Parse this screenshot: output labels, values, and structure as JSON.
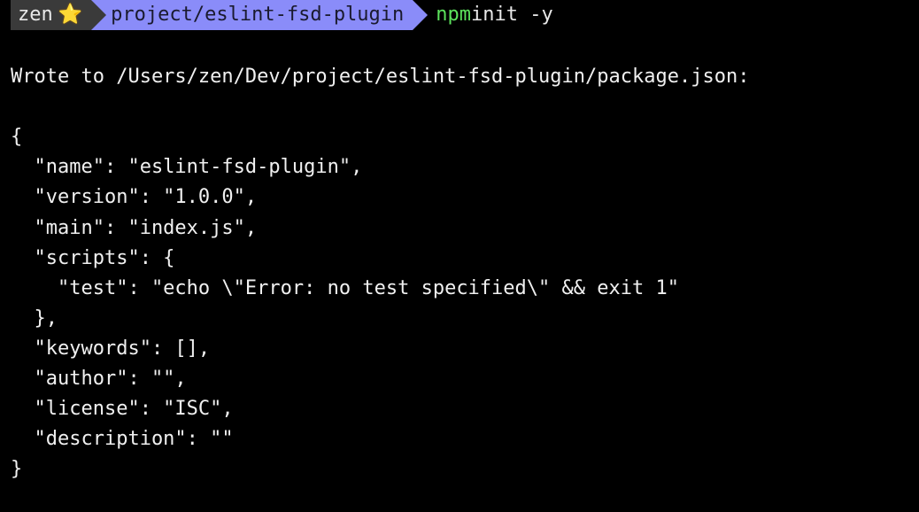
{
  "prompt": {
    "user": "zen",
    "star": "⭐",
    "path": "project/eslint-fsd-plugin",
    "cmd_bin": "npm",
    "cmd_args": " init -y"
  },
  "output": {
    "line1": "Wrote to /Users/zen/Dev/project/eslint-fsd-plugin/package.json:",
    "blank": "",
    "l_open": "{",
    "l_name": "  \"name\": \"eslint-fsd-plugin\",",
    "l_version": "  \"version\": \"1.0.0\",",
    "l_main": "  \"main\": \"index.js\",",
    "l_scripts_open": "  \"scripts\": {",
    "l_test": "    \"test\": \"echo \\\"Error: no test specified\\\" && exit 1\"",
    "l_scripts_close": "  },",
    "l_keywords": "  \"keywords\": [],",
    "l_author": "  \"author\": \"\",",
    "l_license": "  \"license\": \"ISC\",",
    "l_description": "  \"description\": \"\"",
    "l_close": "}"
  }
}
